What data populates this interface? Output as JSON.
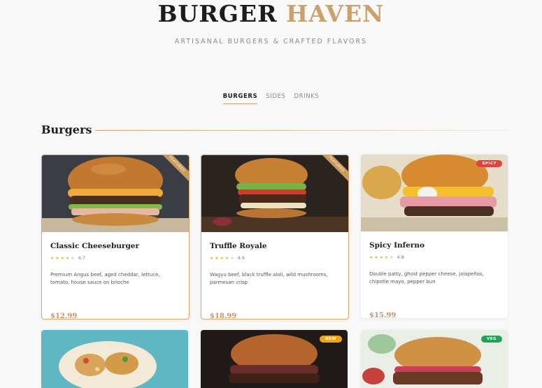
{
  "brand": {
    "part1": "BURGER",
    "part2": "HAVEN",
    "tagline": "ARTISANAL BURGERS & CRAFTED FLAVORS"
  },
  "tabs": [
    {
      "label": "BURGERS",
      "active": true
    },
    {
      "label": "SIDES",
      "active": false
    },
    {
      "label": "DRINKS",
      "active": false
    }
  ],
  "section": {
    "title": "Burgers"
  },
  "cards": [
    {
      "name": "Classic Cheeseburger",
      "rating": "4.7",
      "description": "Premium Angus beef, aged cheddar, lettuce, tomato, house sauce on brioche",
      "price": "$12.99",
      "ribbon": "FEATURED"
    },
    {
      "name": "Truffle Royale",
      "rating": "4.9",
      "description": "Wagyu beef, black truffle aioli, wild mushrooms, parmesan crisp",
      "price": "$18.99",
      "ribbon": "FEATURED"
    },
    {
      "name": "Spicy Inferno",
      "rating": "4.8",
      "description": "Double patty, ghost pepper cheese, jalapeños, chipotle mayo, pepper bun",
      "price": "$15.99",
      "badge": "SPICY"
    },
    {
      "badge": "NEW"
    },
    {
      "badge": "VEG"
    }
  ],
  "colors": {
    "accent": "#caa169",
    "spicy": "#e8413b",
    "new": "#f3a511",
    "veg": "#1fa35a"
  }
}
